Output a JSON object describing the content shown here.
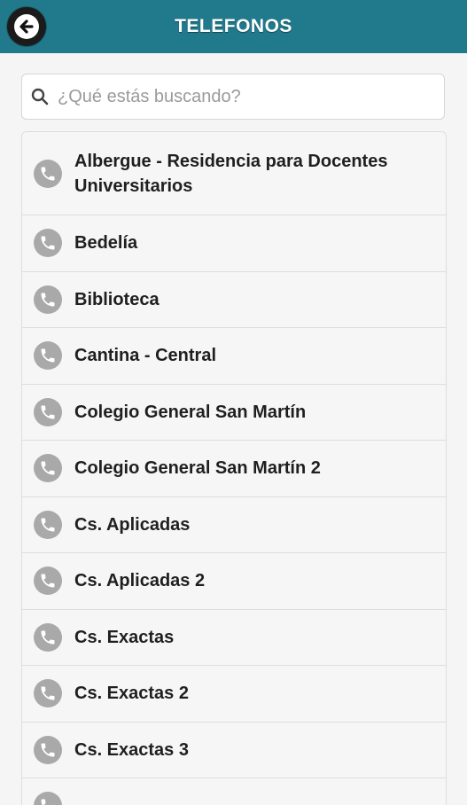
{
  "header": {
    "title": "TELEFONOS",
    "back_icon": "arrow-left-icon",
    "color": "#207a8c"
  },
  "search": {
    "placeholder": "¿Qué estás buscando?",
    "value": "",
    "icon": "search-icon"
  },
  "list": {
    "item_icon": "phone-icon",
    "items": [
      {
        "label": "Albergue - Residencia para Docentes Universitarios"
      },
      {
        "label": "Bedelía"
      },
      {
        "label": "Biblioteca"
      },
      {
        "label": "Cantina - Central"
      },
      {
        "label": "Colegio General San Martín"
      },
      {
        "label": "Colegio General San Martín 2"
      },
      {
        "label": "Cs. Aplicadas"
      },
      {
        "label": "Cs. Aplicadas 2"
      },
      {
        "label": "Cs. Exactas"
      },
      {
        "label": "Cs. Exactas 2"
      },
      {
        "label": "Cs. Exactas 3"
      },
      {
        "label": ""
      }
    ]
  }
}
